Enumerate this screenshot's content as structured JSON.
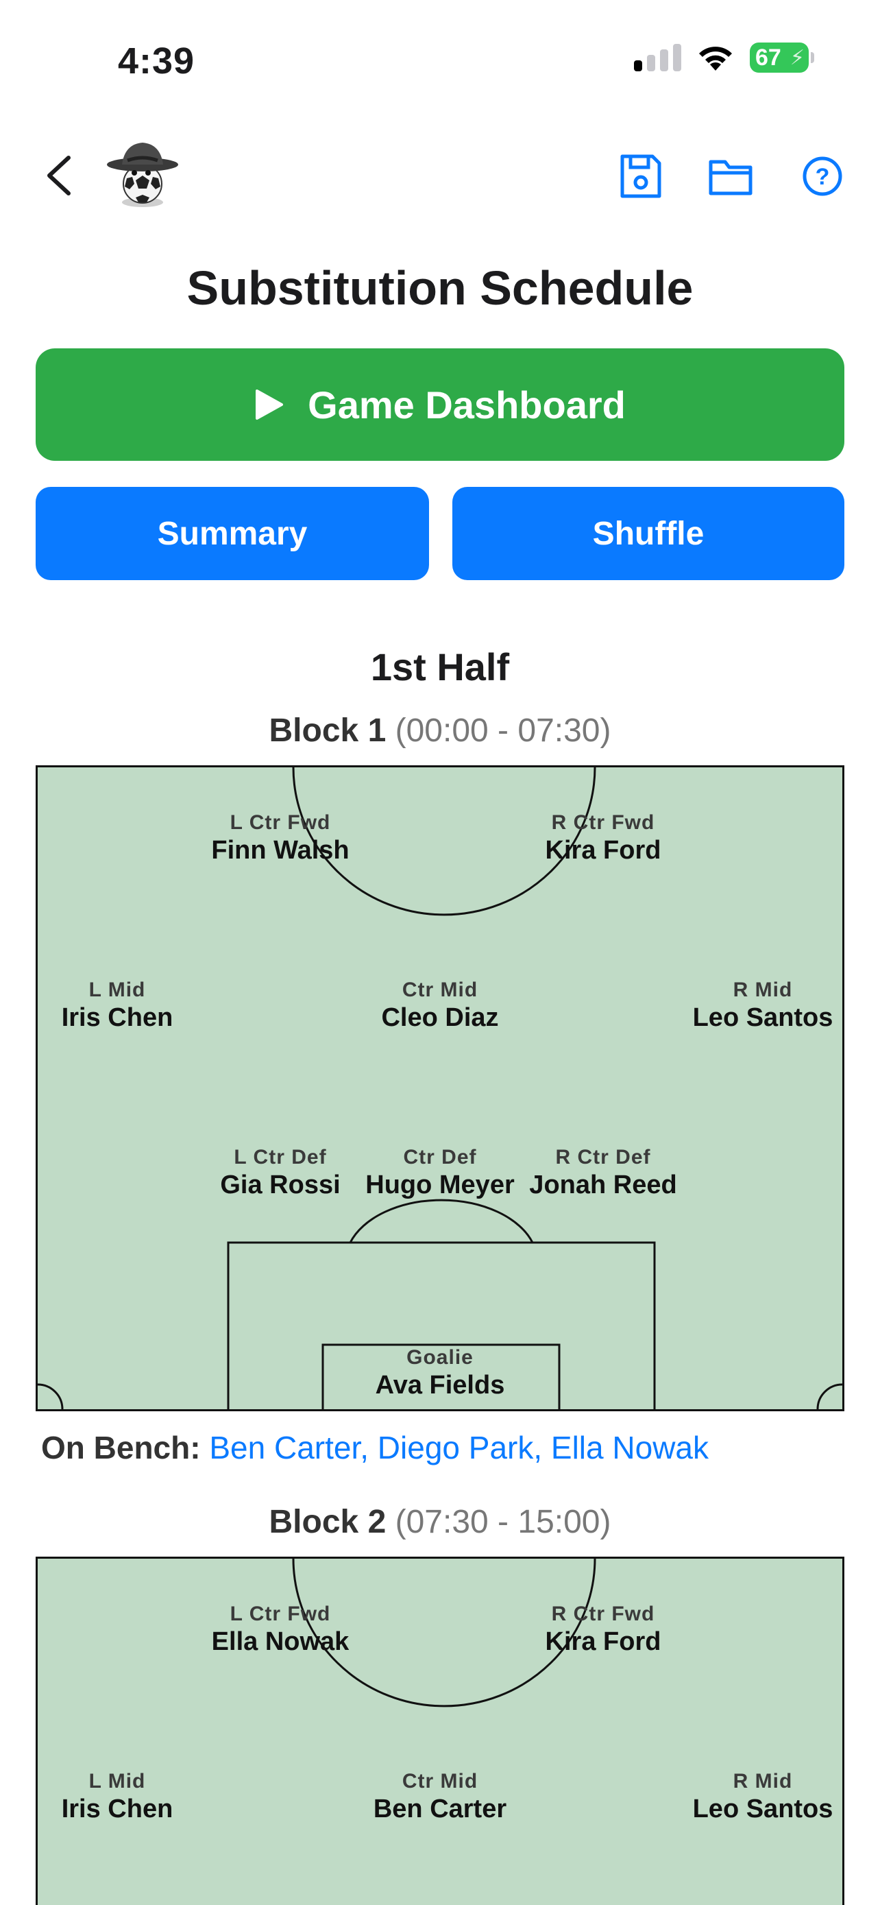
{
  "status_bar": {
    "time": "4:39",
    "battery": "67"
  },
  "nav": {
    "icons": [
      "chevron-left-icon",
      "team-logo",
      "save-icon",
      "folder-icon",
      "help-icon"
    ],
    "accent": "#0a7aff"
  },
  "title": "Substitution Schedule",
  "buttons": {
    "dashboard": "Game Dashboard",
    "summary": "Summary",
    "shuffle": "Shuffle",
    "dashboard_color": "#2eaa48",
    "secondary_color": "#0a7aff"
  },
  "half_title": "1st Half",
  "blocks": [
    {
      "label": "Block 1",
      "time": "(00:00 - 07:30)",
      "positions": {
        "l_ctr_fwd": {
          "role": "L Ctr Fwd",
          "player": "Finn Walsh"
        },
        "r_ctr_fwd": {
          "role": "R Ctr Fwd",
          "player": "Kira Ford"
        },
        "l_mid": {
          "role": "L Mid",
          "player": "Iris Chen"
        },
        "ctr_mid": {
          "role": "Ctr Mid",
          "player": "Cleo Diaz"
        },
        "r_mid": {
          "role": "R Mid",
          "player": "Leo Santos"
        },
        "l_ctr_def": {
          "role": "L Ctr Def",
          "player": "Gia Rossi"
        },
        "ctr_def": {
          "role": "Ctr Def",
          "player": "Hugo Meyer"
        },
        "r_ctr_def": {
          "role": "R Ctr Def",
          "player": "Jonah Reed"
        },
        "goalie": {
          "role": "Goalie",
          "player": "Ava Fields"
        }
      },
      "bench_label": "On Bench:",
      "bench": "Ben Carter, Diego Park, Ella Nowak"
    },
    {
      "label": "Block 2",
      "time": "(07:30 - 15:00)",
      "positions": {
        "l_ctr_fwd": {
          "role": "L Ctr Fwd",
          "player": "Ella Nowak"
        },
        "r_ctr_fwd": {
          "role": "R Ctr Fwd",
          "player": "Kira Ford"
        },
        "l_mid": {
          "role": "L Mid",
          "player": "Iris Chen"
        },
        "ctr_mid": {
          "role": "Ctr Mid",
          "player": "Ben Carter"
        },
        "r_mid": {
          "role": "R Mid",
          "player": "Leo Santos"
        }
      }
    }
  ]
}
